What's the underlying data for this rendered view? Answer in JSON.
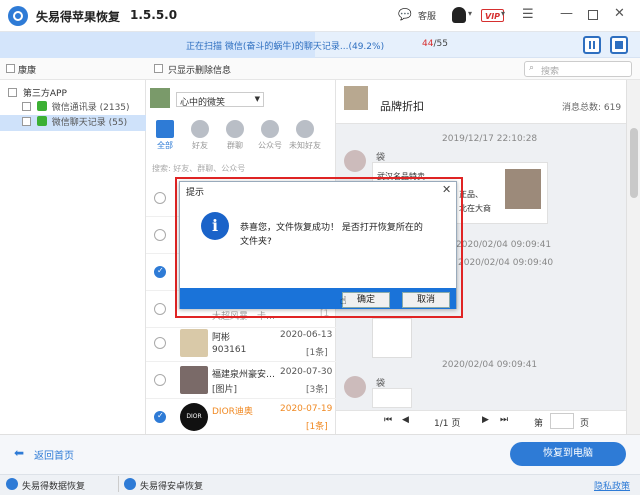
{
  "app": {
    "title": "失易得苹果恢复",
    "version": "1.5.5.0",
    "service_label": "客服",
    "vip_label": "VIP"
  },
  "progress": {
    "text": "正在扫描 微信(奋斗的蜗牛)的聊天记录...",
    "percent_text": "(49.2%)",
    "percent": 49.2,
    "current": "44",
    "total": "/55"
  },
  "headers": {
    "left": "康康",
    "mid": "只显示删除信息",
    "search_placeholder": "搜索"
  },
  "tree": {
    "root": "第三方APP",
    "items": [
      {
        "label": "微信通讯录 (2135)"
      },
      {
        "label": "微信聊天记录 (55)"
      }
    ]
  },
  "account": {
    "name": "心中的微笑"
  },
  "filter_tabs": [
    {
      "label": "全部"
    },
    {
      "label": "好友"
    },
    {
      "label": "群聊"
    },
    {
      "label": "公众号"
    },
    {
      "label": "未知好友"
    }
  ],
  "search_hint": "搜索: 好友、群聊、公众号",
  "contacts": [
    {
      "name": "大超风暴—卡…",
      "date": "",
      "msg": "",
      "count": "[1"
    },
    {
      "name": "阿彬",
      "date": "2020-06-13",
      "msg": "903161",
      "count": "[1条]"
    },
    {
      "name": "福建泉州豪安…",
      "date": "2020-07-30",
      "msg": "[图片]",
      "count": "[3条]"
    },
    {
      "name": "DIOR迪奥",
      "date": "2020-07-19",
      "msg": "",
      "count": "[1条]"
    }
  ],
  "chat": {
    "title": "品牌折扣",
    "msg_total_label": "消息总数: 619",
    "date1": "2019/12/17 22:10:28",
    "sender1": "袋",
    "bubble1": "武汉名品特卖",
    "bubble1b": "正品、",
    "bubble1c": "北在大商",
    "date2": "2020/02/04 09:09:41",
    "date3": "2020/02/04 09:09:40",
    "date4": "2020/02/04 09:09:41",
    "sender4": "袋",
    "pager": "1/1 页",
    "goto_label": "第",
    "page_suffix": "页"
  },
  "bottom": {
    "back_label": "返回首页",
    "recover_label": "恢复到电脑"
  },
  "status": {
    "item1": "失易得数据恢复",
    "item2": "失易得安卓恢复",
    "privacy": "隐私政策"
  },
  "dialog": {
    "title": "提示",
    "message_line1": "恭喜您，文件恢复成功！ 是否打开恢复所在的",
    "message_line2": "文件夹?",
    "ok_label": "确定",
    "cancel_label": "取消"
  },
  "colors": {
    "accent": "#2e7bd6",
    "highlight_red": "#e02424",
    "dior_orange": "#f08a24"
  }
}
